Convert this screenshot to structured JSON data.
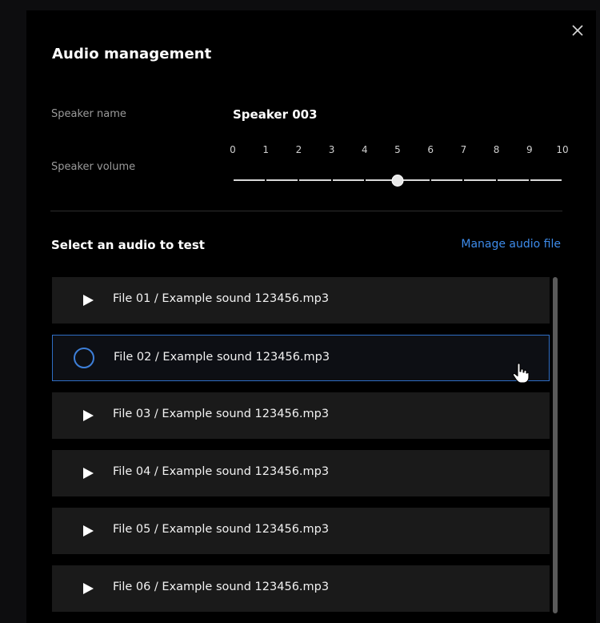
{
  "dialog": {
    "title": "Audio management",
    "close_icon": "close-icon"
  },
  "speaker": {
    "name_label": "Speaker name",
    "name_value": "Speaker 003",
    "volume_label": "Speaker volume",
    "volume_ticks": [
      "0",
      "1",
      "2",
      "3",
      "4",
      "5",
      "6",
      "7",
      "8",
      "9",
      "10"
    ],
    "volume_value": 5,
    "volume_min": 0,
    "volume_max": 10
  },
  "audio": {
    "section_title": "Select an audio to test",
    "manage_link": "Manage audio file",
    "items": [
      {
        "label": "File 01 /  Example sound 123456.mp3",
        "state": "play",
        "icon": "play-icon"
      },
      {
        "label": "File 02 /  Example sound 123456.mp3",
        "state": "loading",
        "icon": "loading-icon"
      },
      {
        "label": "File 03 /  Example sound 123456.mp3",
        "state": "play",
        "icon": "play-icon"
      },
      {
        "label": "File 04 /  Example sound 123456.mp3",
        "state": "play",
        "icon": "play-icon"
      },
      {
        "label": "File 05 /  Example sound 123456.mp3",
        "state": "play",
        "icon": "play-icon"
      },
      {
        "label": "File 06 /  Example sound 123456.mp3",
        "state": "play",
        "icon": "play-icon"
      }
    ]
  },
  "colors": {
    "accent": "#3d8bea",
    "selected_border": "#2f6dc4",
    "item_background": "#1a1a1a",
    "dialog_background": "#000000"
  }
}
